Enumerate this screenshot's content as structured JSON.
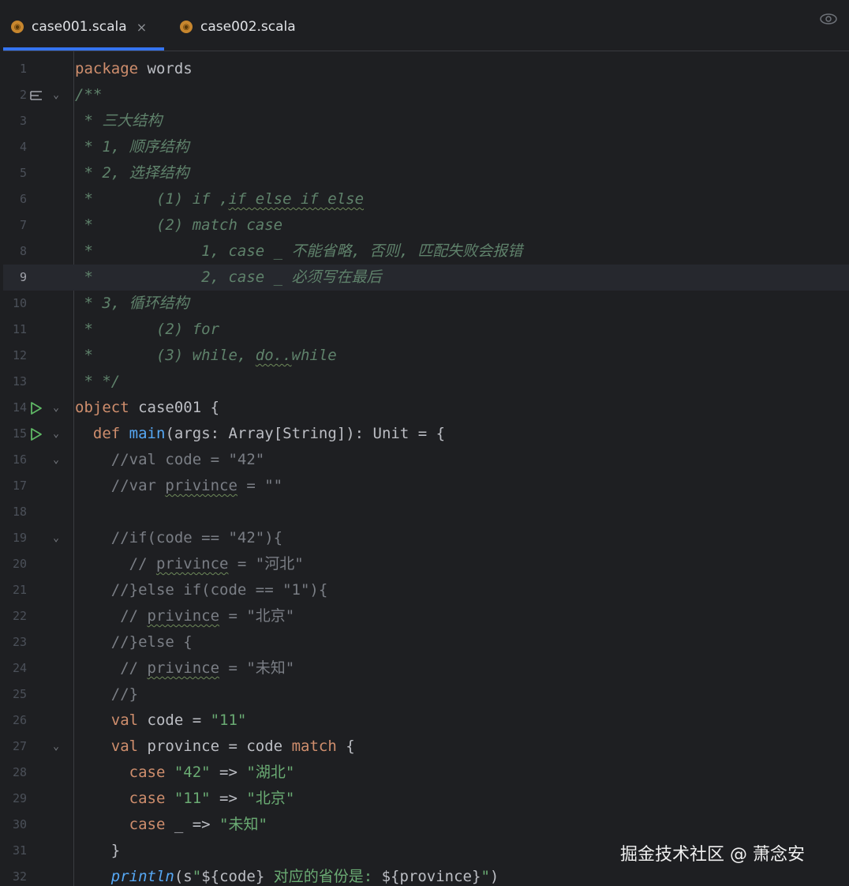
{
  "tabs": [
    {
      "name": "case001.scala",
      "close": "×",
      "icon": "scala-file-icon"
    },
    {
      "name": "case002.scala",
      "icon": "scala-file-icon"
    }
  ],
  "lines": [
    {
      "n": "1"
    },
    {
      "n": "2"
    },
    {
      "n": "3"
    },
    {
      "n": "4"
    },
    {
      "n": "5"
    },
    {
      "n": "6"
    },
    {
      "n": "7"
    },
    {
      "n": "8"
    },
    {
      "n": "9"
    },
    {
      "n": "10"
    },
    {
      "n": "11"
    },
    {
      "n": "12"
    },
    {
      "n": "13"
    },
    {
      "n": "14"
    },
    {
      "n": "15"
    },
    {
      "n": "16"
    },
    {
      "n": "17"
    },
    {
      "n": "18"
    },
    {
      "n": "19"
    },
    {
      "n": "20"
    },
    {
      "n": "21"
    },
    {
      "n": "22"
    },
    {
      "n": "23"
    },
    {
      "n": "24"
    },
    {
      "n": "25"
    },
    {
      "n": "26"
    },
    {
      "n": "27"
    },
    {
      "n": "28"
    },
    {
      "n": "29"
    },
    {
      "n": "30"
    },
    {
      "n": "31"
    },
    {
      "n": "32"
    }
  ],
  "code": {
    "l1": {
      "kw": "package",
      "rest": " words"
    },
    "l2": "/**",
    "l3": " * 三大结构",
    "l4": " * 1, 顺序结构",
    "l5": " * 2, 选择结构",
    "l6": {
      "a": " *       (1) if ,",
      "b": "if else if else"
    },
    "l7": " *       (2) match case",
    "l8": " *            1, case _ 不能省略, 否则, 匹配失败会报错",
    "l9": " *            2, case _ 必须写在最后",
    "l10": " * 3, 循环结构",
    "l11": " *       (2) for",
    "l12": {
      "a": " *       (3) while, ",
      "b": "do..",
      "c": "while"
    },
    "l13": " * */",
    "l14": {
      "kw": "object",
      "rest": " case001 {"
    },
    "l15": {
      "indent": "  ",
      "kw": "def",
      "fn": "main",
      "rest": "(args: Array[String]): Unit = {"
    },
    "l16": "    //val code = \"42\"",
    "l17": {
      "a": "    //var ",
      "b": "privince",
      "c": " = \"\""
    },
    "l18": "",
    "l19": "    //if(code == \"42\"){",
    "l20": {
      "a": "      // ",
      "b": "privince",
      "c": " = \"河北\""
    },
    "l21": "    //}else if(code == \"1\"){",
    "l22": {
      "a": "     // ",
      "b": "privince",
      "c": " = \"北京\""
    },
    "l23": "    //}else {",
    "l24": {
      "a": "     // ",
      "b": "privince",
      "c": " = \"未知\""
    },
    "l25": "    //}",
    "l26": {
      "indent": "    ",
      "kw": "val",
      "mid": " code = ",
      "str": "\"11\""
    },
    "l27": {
      "indent": "    ",
      "kw": "val",
      "mid": " province = code ",
      "kw2": "match",
      "rest": " {"
    },
    "l28": {
      "indent": "      ",
      "kw": "case",
      "str1": " \"42\"",
      "arrow": " => ",
      "str2": "\"湖北\""
    },
    "l29": {
      "indent": "      ",
      "kw": "case",
      "str1": " \"11\"",
      "arrow": " => ",
      "str2": "\"北京\""
    },
    "l30": {
      "indent": "      ",
      "kw": "case",
      "mid": " _ => ",
      "str2": "\"未知\""
    },
    "l31": "    }",
    "l32": {
      "indent": "    ",
      "fn": "println",
      "a": "(s",
      "s1": "\"",
      "d1": "${code}",
      "s2": " 对应的省份是: ",
      "d2": "${province}",
      "s3": "\"",
      "b": ")"
    }
  },
  "watermark": "掘金技术社区 @ 萧念安",
  "colors": {
    "background": "#1e1f22",
    "keyword": "#cf8e6d",
    "string": "#6aab73",
    "comment": "#7a7e85",
    "doc_comment": "#5f826b",
    "function": "#56a8f5",
    "accent": "#3574f0"
  }
}
